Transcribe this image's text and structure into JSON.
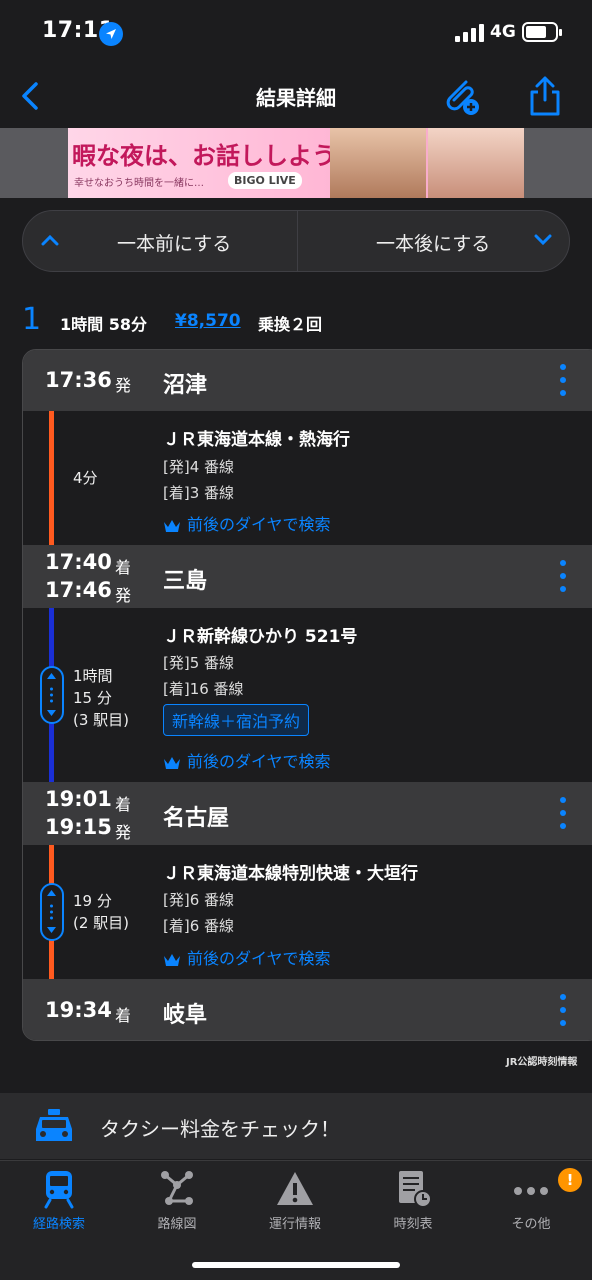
{
  "status_bar": {
    "time": "17:11",
    "network": "4G"
  },
  "nav": {
    "title": "結果詳細"
  },
  "ad": {
    "headline": "暇な夜は、お話ししよう？",
    "subtext": "幸せなおうち時間を一緒に…",
    "logo": "BIGO LIVE"
  },
  "prev_next": {
    "prev_label": "一本前にする",
    "next_label": "一本後にする"
  },
  "summary": {
    "route_number": "1",
    "duration": "1時間 58分",
    "fare": "¥8,570",
    "transfers": "乗換２回"
  },
  "stations": [
    {
      "times": [
        {
          "time": "17:36",
          "suffix": "発"
        }
      ],
      "name": "沼津"
    },
    {
      "times": [
        {
          "time": "17:40",
          "suffix": "着"
        },
        {
          "time": "17:46",
          "suffix": "発"
        }
      ],
      "name": "三島"
    },
    {
      "times": [
        {
          "time": "19:01",
          "suffix": "着"
        },
        {
          "time": "19:15",
          "suffix": "発"
        }
      ],
      "name": "名古屋"
    },
    {
      "times": [
        {
          "time": "19:34",
          "suffix": "着"
        }
      ],
      "name": "岐阜"
    }
  ],
  "segments": [
    {
      "line_color": "#ff5a1f",
      "duration": "4分",
      "train": "ＪＲ東海道本線・熱海行",
      "dep_platform": "[発]4 番線",
      "arr_platform": "[着]3 番線",
      "search_link": "前後のダイヤで検索"
    },
    {
      "line_color": "#1a2fd6",
      "duration_line1": "1時間",
      "duration_line2": "15 分",
      "stops": "(3 駅目)",
      "train": "ＪＲ新幹線ひかり 521号",
      "dep_platform": "[発]5 番線",
      "arr_platform": "[着]16 番線",
      "booking": "新幹線＋宿泊予約",
      "search_link": "前後のダイヤで検索"
    },
    {
      "line_color": "#ff5a1f",
      "duration_line1": "19 分",
      "stops": "(2 駅目)",
      "train": "ＪＲ東海道本線特別快速・大垣行",
      "dep_platform": "[発]6 番線",
      "arr_platform": "[着]6 番線",
      "search_link": "前後のダイヤで検索"
    }
  ],
  "jr_credit": "JR公認時刻情報",
  "taxi": {
    "label": "タクシー料金をチェック！"
  },
  "tabs": [
    {
      "label": "経路検索",
      "icon": "train-icon",
      "active": true
    },
    {
      "label": "路線図",
      "icon": "route-map-icon"
    },
    {
      "label": "運行情報",
      "icon": "warning-icon"
    },
    {
      "label": "時刻表",
      "icon": "timetable-icon"
    },
    {
      "label": "その他",
      "icon": "more-dots-icon",
      "badge": "!"
    }
  ],
  "colors": {
    "accent": "#0a84ff",
    "background": "#1c1c1e",
    "station_row": "#3a3a3c",
    "badge": "#ff9500"
  }
}
